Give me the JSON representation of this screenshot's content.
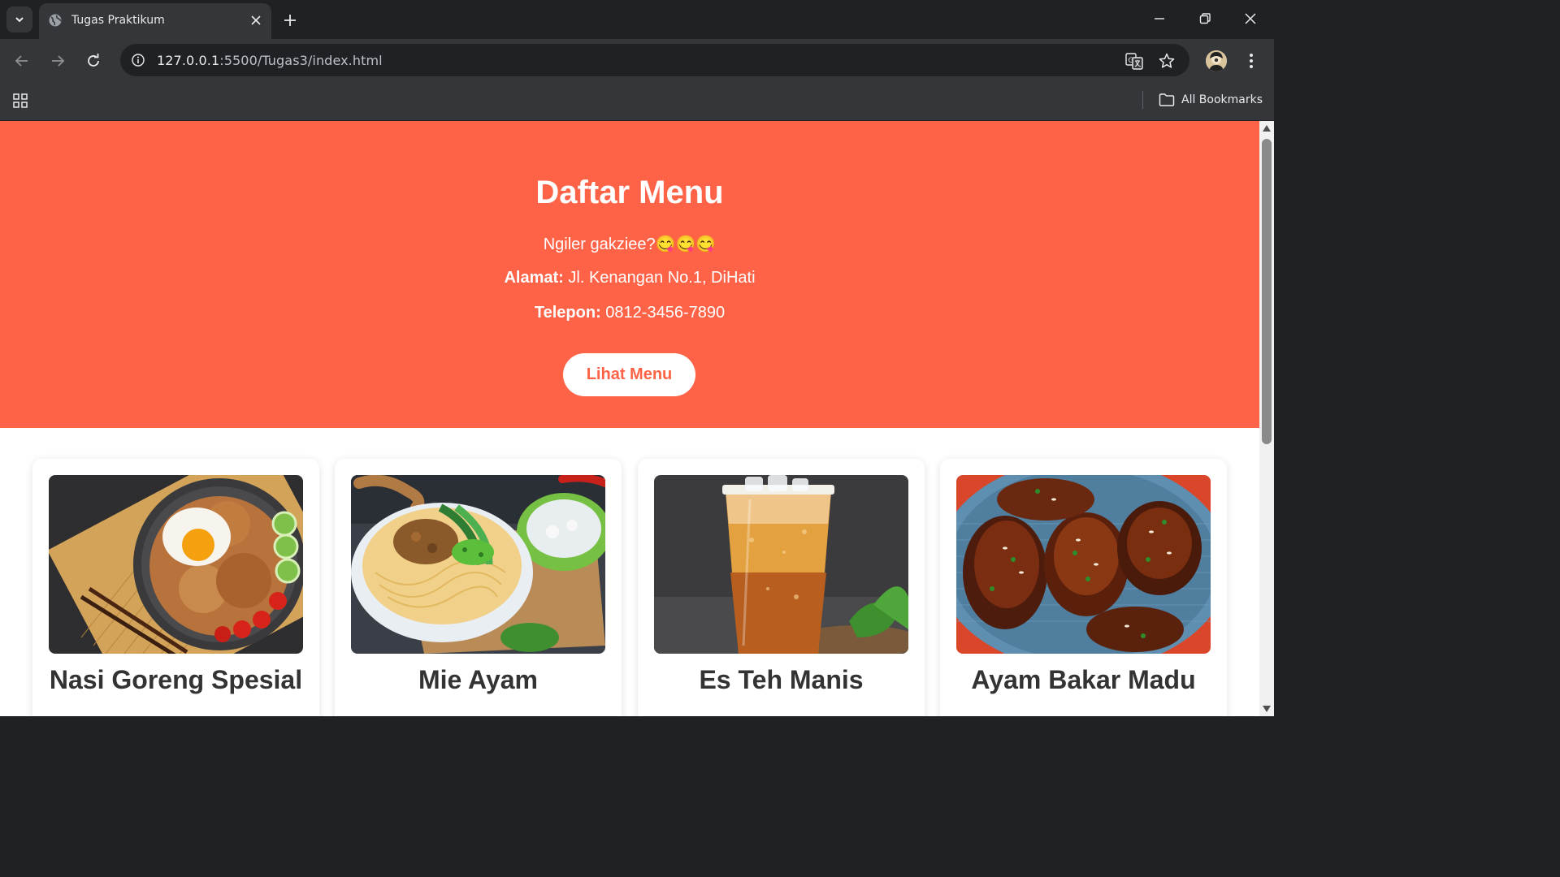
{
  "browser": {
    "tab_title": "Tugas Praktikum",
    "url_host": "127.0.0.1",
    "url_rest": ":5500/Tugas3/index.html",
    "bookmarks_label": "All Bookmarks"
  },
  "hero": {
    "title": "Daftar Menu",
    "tagline": "Ngiler gakziee?😋😋😋",
    "address_label": "Alamat:",
    "address_value": " Jl. Kenangan No.1, DiHati",
    "phone_label": "Telepon:",
    "phone_value": " 0812-3456-7890",
    "button_label": "Lihat Menu",
    "bg_color": "#ff6347"
  },
  "menu": {
    "items": [
      {
        "name": "Nasi Goreng Spesial",
        "image_icon": "fried-rice-photo"
      },
      {
        "name": "Mie Ayam",
        "image_icon": "chicken-noodle-photo"
      },
      {
        "name": "Es Teh Manis",
        "image_icon": "iced-tea-photo"
      },
      {
        "name": "Ayam Bakar Madu",
        "image_icon": "grilled-chicken-photo"
      }
    ]
  }
}
